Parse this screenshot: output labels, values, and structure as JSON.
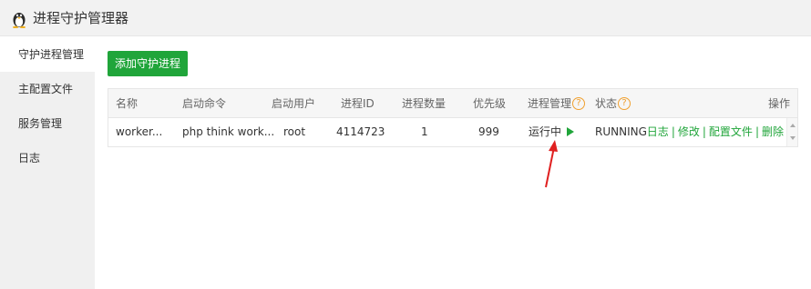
{
  "app": {
    "title": "进程守护管理器",
    "icon": "penguin-icon"
  },
  "sidebar": {
    "items": [
      {
        "label": "守护进程管理",
        "active": true
      },
      {
        "label": "主配置文件",
        "active": false
      },
      {
        "label": "服务管理",
        "active": false
      },
      {
        "label": "日志",
        "active": false
      }
    ]
  },
  "toolbar": {
    "add_label": "添加守护进程"
  },
  "table": {
    "headers": {
      "name": "名称",
      "command": "启动命令",
      "user": "启动用户",
      "pid": "进程ID",
      "count": "进程数量",
      "priority": "优先级",
      "manage": "进程管理",
      "status": "状态",
      "ops": "操作"
    },
    "help_glyph": "?",
    "rows": [
      {
        "name": "worker...",
        "command": "php think work...",
        "user": "root",
        "pid": "4114723",
        "count": "1",
        "priority": "999",
        "manage": "运行中",
        "status": "RUNNING",
        "ops": {
          "log": "日志",
          "edit": "修改",
          "config": "配置文件",
          "delete": "删除"
        },
        "sep": "|"
      }
    ]
  },
  "colors": {
    "accent": "#20a53a",
    "help": "#f0a030",
    "annotation": "#e02020"
  }
}
